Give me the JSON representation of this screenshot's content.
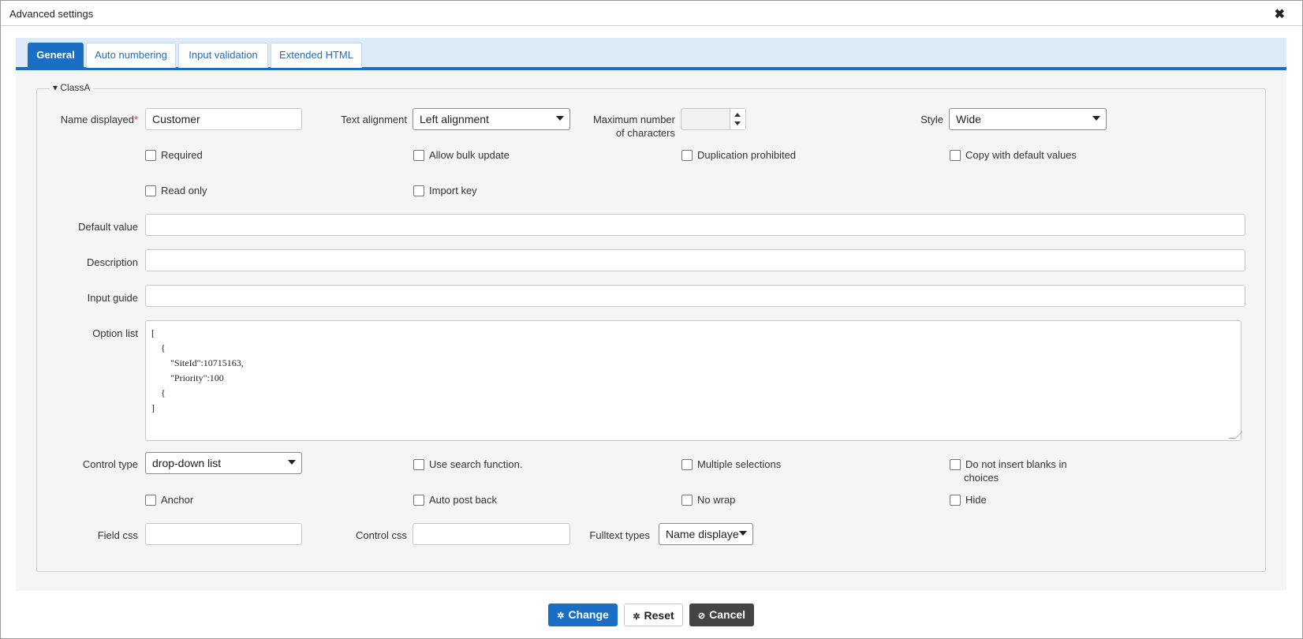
{
  "dialog": {
    "title": "Advanced settings",
    "close_glyph": "✖"
  },
  "tabs": [
    {
      "label": "General",
      "active": true
    },
    {
      "label": "Auto numbering"
    },
    {
      "label": "Input validation"
    },
    {
      "label": "Extended HTML"
    }
  ],
  "fieldset": {
    "legend": "ClassA",
    "toggle_glyph": "▾"
  },
  "fields": {
    "name_displayed": {
      "label": "Name displayed",
      "required_mark": "*",
      "value": "Customer"
    },
    "text_alignment": {
      "label": "Text alignment",
      "value": "Left alignment"
    },
    "max_chars": {
      "label_line1": "Maximum number",
      "label_line2": "of characters",
      "value": ""
    },
    "style": {
      "label": "Style",
      "value": "Wide"
    },
    "default_value": {
      "label": "Default value",
      "value": ""
    },
    "description": {
      "label": "Description",
      "value": ""
    },
    "input_guide": {
      "label": "Input guide",
      "value": ""
    },
    "option_list": {
      "label": "Option list",
      "lines": [
        "[",
        "    {",
        "        \"SiteId\":10715163,",
        "        \"Priority\":100",
        "    {",
        "]"
      ]
    },
    "control_type": {
      "label": "Control type",
      "value": "drop-down list"
    },
    "field_css": {
      "label": "Field css",
      "value": ""
    },
    "control_css": {
      "label": "Control css",
      "value": ""
    },
    "fulltext_types": {
      "label": "Fulltext types",
      "value": "Name displaye"
    }
  },
  "checkboxes": {
    "required": {
      "label": "Required",
      "checked": false
    },
    "allow_bulk_update": {
      "label": "Allow bulk update",
      "checked": false
    },
    "duplication_prohibited": {
      "label": "Duplication prohibited",
      "checked": false
    },
    "copy_with_default": {
      "label": "Copy with default values",
      "checked": false
    },
    "read_only": {
      "label": "Read only",
      "checked": false
    },
    "import_key": {
      "label": "Import key",
      "checked": false
    },
    "use_search": {
      "label": "Use search function.",
      "checked": false
    },
    "multiple_selections": {
      "label": "Multiple selections",
      "checked": false
    },
    "no_blanks_line1": {
      "label": "Do not insert blanks in",
      "checked": false
    },
    "no_blanks_line2": "choices",
    "anchor": {
      "label": "Anchor",
      "checked": false
    },
    "auto_post_back": {
      "label": "Auto post back",
      "checked": false
    },
    "no_wrap": {
      "label": "No wrap",
      "checked": false
    },
    "hide": {
      "label": "Hide",
      "checked": false
    }
  },
  "buttons": {
    "change": {
      "label": "Change",
      "icon": "gear-icon"
    },
    "reset": {
      "label": "Reset",
      "icon": "gear-icon"
    },
    "cancel": {
      "label": "Cancel",
      "icon": "cancel-icon"
    }
  },
  "colors": {
    "accent": "#1a6fc4",
    "tab_bg": "#dcebf7",
    "panel_bg": "#f5f5f5",
    "cancel_bg": "#444444"
  }
}
